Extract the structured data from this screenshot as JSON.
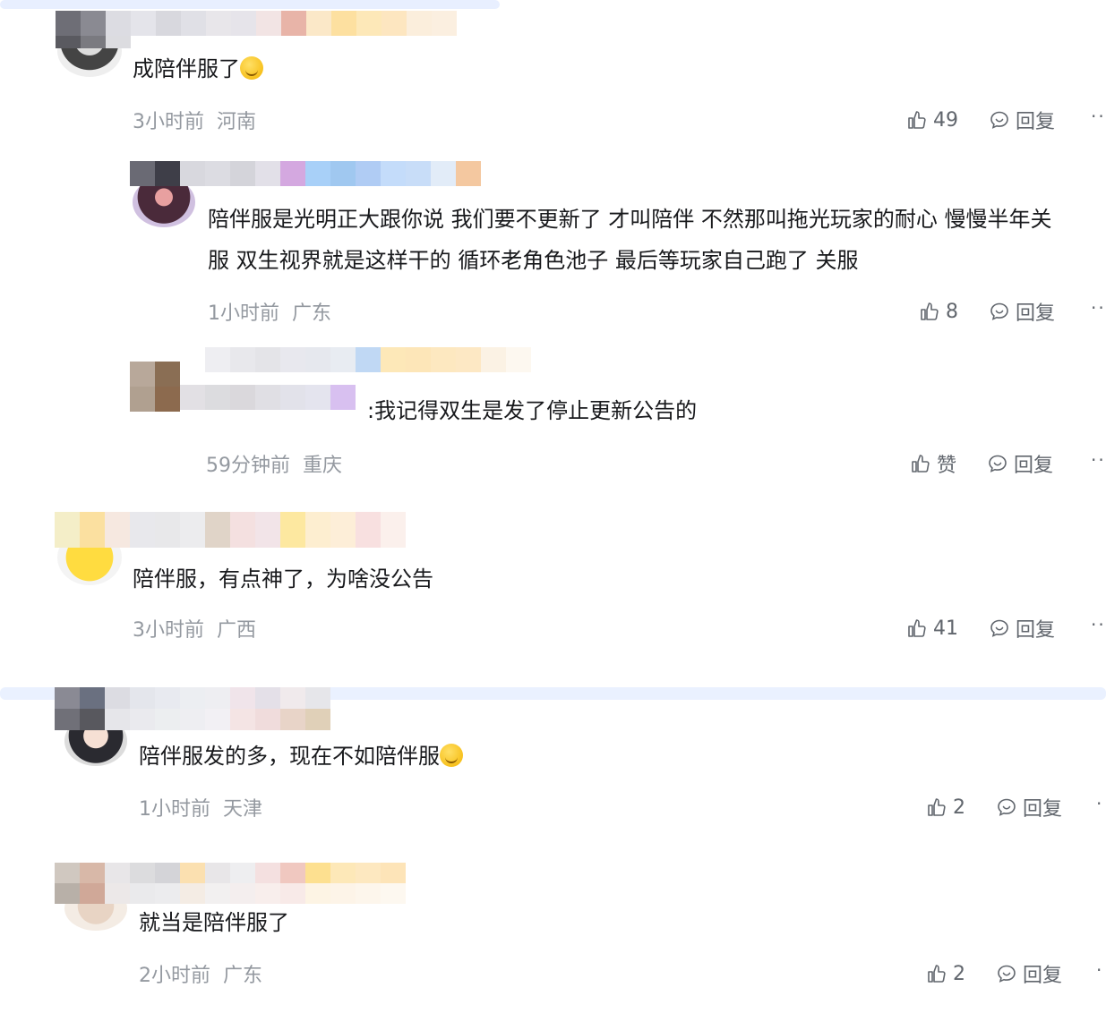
{
  "comments": [
    {
      "text": "成陪伴服了",
      "emoji": "yawn-emoji",
      "time": "3小时前",
      "location": "河南",
      "likes": "49",
      "reply_label": "回复",
      "more": "··"
    },
    {
      "text_line1": "陪伴服是光明正大跟你说 我们要不更新了 才叫陪伴 不然那叫拖光玩家的耐心 慢慢半年关",
      "text_line2": "服 双生视界就是这样干的 循环老角色池子 最后等玩家自己跑了 关服",
      "time": "1小时前",
      "location": "广东",
      "likes": "8",
      "reply_label": "回复",
      "more": "··"
    },
    {
      "text": ":我记得双生是发了停止更新公告的",
      "time": "59分钟前",
      "location": "重庆",
      "likes": "赞",
      "reply_label": "回复",
      "more": "··"
    },
    {
      "text": "陪伴服，有点神了，为啥没公告",
      "time": "3小时前",
      "location": "广西",
      "likes": "41",
      "reply_label": "回复",
      "more": "··"
    },
    {
      "text": "陪伴服发的多，现在不如陪伴服",
      "emoji": "smile-emoji",
      "time": "1小时前",
      "location": "天津",
      "likes": "2",
      "reply_label": "回复",
      "more": "·"
    },
    {
      "text": "就当是陪伴服了",
      "time": "2小时前",
      "location": "广东",
      "likes": "2",
      "reply_label": "回复",
      "more": "·"
    }
  ],
  "colors": {
    "text": "#18191c",
    "meta": "#9499a0",
    "action": "#61666d"
  }
}
